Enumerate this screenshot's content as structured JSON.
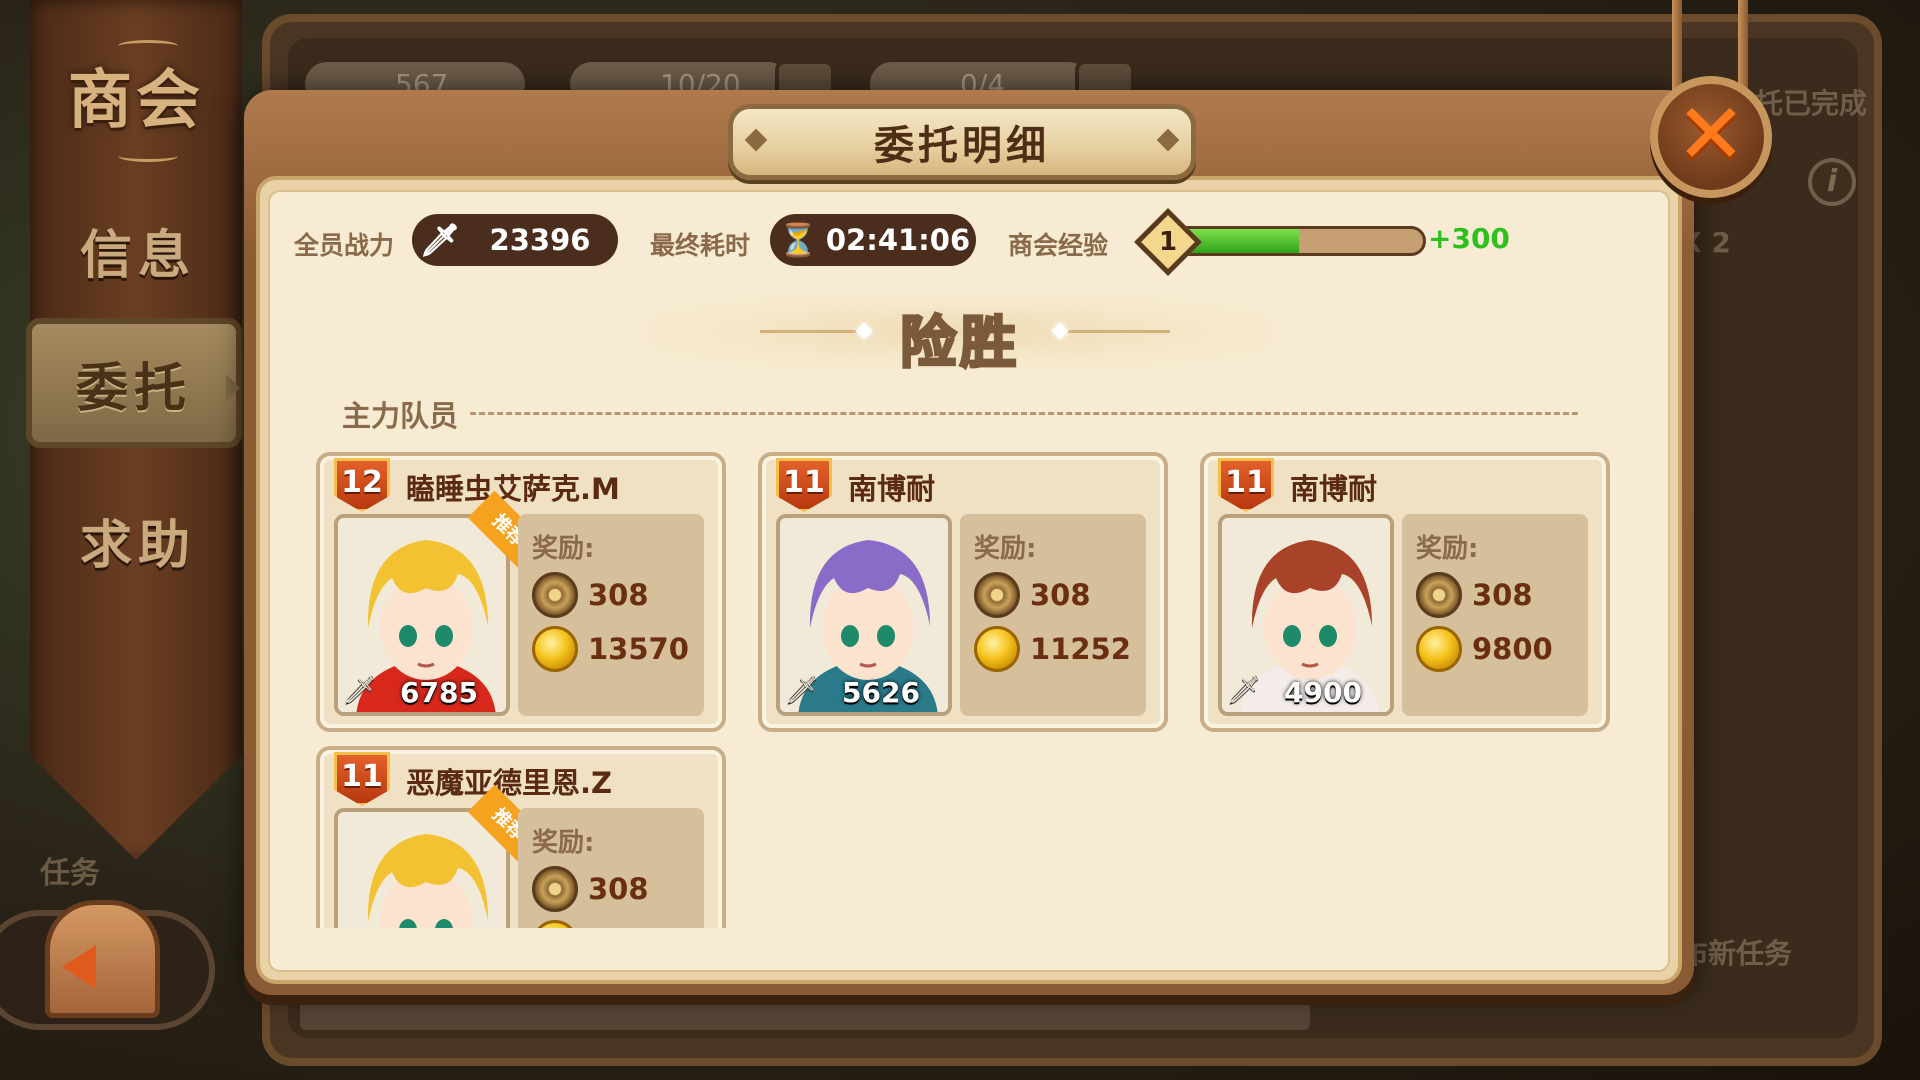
{
  "sidebar": {
    "title": "商会",
    "items": [
      {
        "label": "信息"
      },
      {
        "label": "委托"
      },
      {
        "label": "求助"
      }
    ],
    "tasks_label": "任务"
  },
  "background": {
    "res1": "567",
    "res2": "10/20",
    "res3": "0/4",
    "status_right": "托已完成",
    "count_right": "X 2",
    "new_task": "布新任务"
  },
  "dialog": {
    "title": "委托明细",
    "stats": {
      "power_label": "全员战力",
      "power_value": "23396",
      "time_label": "最终耗时",
      "time_value": "02:41:06",
      "exp_label": "商会经验",
      "exp_level": "1",
      "exp_progress": 0.47,
      "exp_gain": "+300"
    },
    "result": "险胜",
    "section_title": "主力队员",
    "members": [
      {
        "level": "12",
        "name": "瞌睡虫艾萨克.M",
        "power": "6785",
        "recommended": true,
        "tag": "推荐",
        "reward_label": "奖励:",
        "exp": "308",
        "gold": "13570",
        "hair": "#f2c233",
        "accent": "#d8281c"
      },
      {
        "level": "11",
        "name": "南博耐",
        "power": "5626",
        "recommended": false,
        "tag": "",
        "reward_label": "奖励:",
        "exp": "308",
        "gold": "11252",
        "hair": "#8a6cc8",
        "accent": "#2a7a8a"
      },
      {
        "level": "11",
        "name": "南博耐",
        "power": "4900",
        "recommended": false,
        "tag": "",
        "reward_label": "奖励:",
        "exp": "308",
        "gold": "9800",
        "hair": "#a8432a",
        "accent": "#f4ece8"
      },
      {
        "level": "11",
        "name": "恶魔亚德里恩.Z",
        "power": "",
        "recommended": true,
        "tag": "推荐",
        "reward_label": "奖励:",
        "exp": "308",
        "gold": "",
        "hair": "#f2c233",
        "accent": "#d8281c"
      }
    ]
  },
  "colors": {
    "accent_orange": "#ff7a1a",
    "exp_green": "#2fbf1f",
    "paper": "#f7ecd3",
    "wood": "#8e5c34"
  }
}
